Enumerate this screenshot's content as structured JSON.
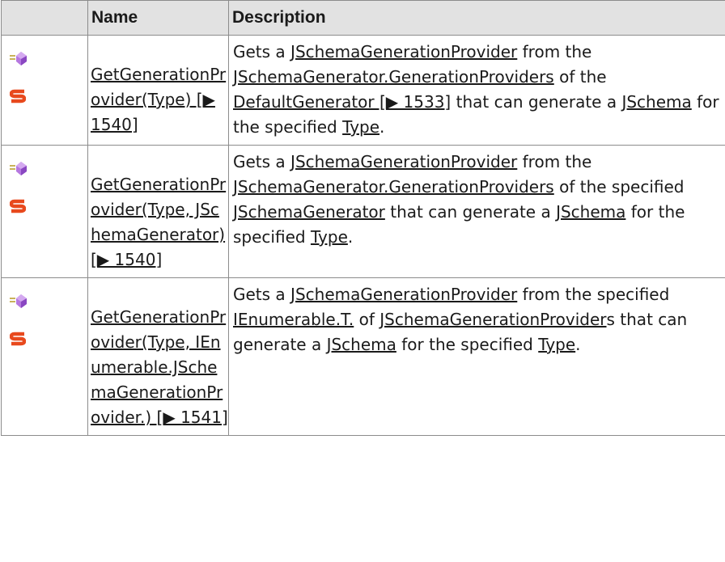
{
  "header": {
    "col_icon": "",
    "col_name": "Name",
    "col_desc": "Description"
  },
  "rows": [
    {
      "icons": [
        "method-icon",
        "static-icon"
      ],
      "name": "GetGenerationProvider(Type) [▶ 1540]",
      "desc": [
        {
          "t": "Gets a ",
          "link": false
        },
        {
          "t": "JSchemaGenerationProvider",
          "link": true
        },
        {
          "t": " from the ",
          "link": false
        },
        {
          "t": "JSchemaGenerator.GenerationProviders",
          "link": true
        },
        {
          "t": " of the ",
          "link": false
        },
        {
          "t": "DefaultGenerator [▶ 1533]",
          "link": true
        },
        {
          "t": " that can generate a ",
          "link": false
        },
        {
          "t": "JSchema",
          "link": true
        },
        {
          "t": " for the specified ",
          "link": false
        },
        {
          "t": "Type",
          "link": true
        },
        {
          "t": ".",
          "link": false
        }
      ]
    },
    {
      "icons": [
        "method-icon",
        "static-icon"
      ],
      "name": "GetGenerationProvider(Type, JSchemaGenerator) [▶ 1540]",
      "desc": [
        {
          "t": "Gets a ",
          "link": false
        },
        {
          "t": "JSchemaGenerationProvider",
          "link": true
        },
        {
          "t": " from the ",
          "link": false
        },
        {
          "t": "JSchemaGenerator.GenerationProviders",
          "link": true
        },
        {
          "t": " of the specified ",
          "link": false
        },
        {
          "t": "JSchemaGenerator",
          "link": true
        },
        {
          "t": " that can generate a ",
          "link": false
        },
        {
          "t": "JSchema",
          "link": true
        },
        {
          "t": " for the specified ",
          "link": false
        },
        {
          "t": "Type",
          "link": true
        },
        {
          "t": ".",
          "link": false
        }
      ]
    },
    {
      "icons": [
        "method-icon",
        "static-icon"
      ],
      "name": "GetGenerationProvider(Type, IEnumerable.JSchemaGenerationProvider.) [▶ 1541]",
      "desc": [
        {
          "t": "Gets a ",
          "link": false
        },
        {
          "t": "JSchemaGenerationProvider",
          "link": true
        },
        {
          "t": " from the specified ",
          "link": false
        },
        {
          "t": "IEnumerable.T.",
          "link": true
        },
        {
          "t": " of ",
          "link": false
        },
        {
          "t": "JSchemaGenerationProvider",
          "link": true
        },
        {
          "t": "s that can generate a ",
          "link": false
        },
        {
          "t": "JSchema",
          "link": true
        },
        {
          "t": " for the specified ",
          "link": false
        },
        {
          "t": "Type",
          "link": true
        },
        {
          "t": ".",
          "link": false
        }
      ]
    }
  ],
  "colors": {
    "header_bg": "#e2e2e2",
    "border": "#8c8c8c",
    "method_icon": "#9b59d0",
    "static_icon": "#e8491d"
  }
}
